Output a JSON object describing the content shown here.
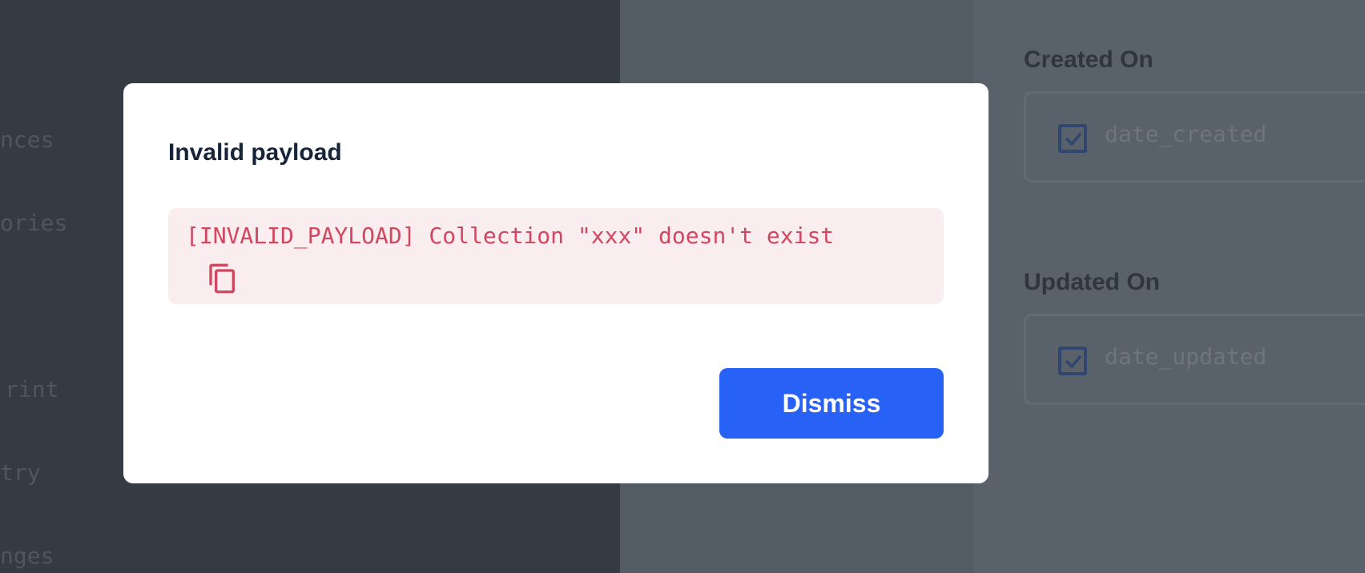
{
  "background": {
    "sidebar_items": [
      {
        "label": "nces"
      },
      {
        "label": "ories"
      },
      {
        "label": "rint"
      },
      {
        "label": "try"
      },
      {
        "label": "nges"
      }
    ],
    "fields": [
      {
        "label": "Created On",
        "value": "date_created",
        "checked": true
      },
      {
        "label": "Updated On",
        "value": "date_updated",
        "checked": true
      }
    ]
  },
  "dialog": {
    "title": "Invalid payload",
    "error_message": "[INVALID_PAYLOAD] Collection \"xxx\" doesn't exist",
    "copy_icon": "copy-icon",
    "dismiss_label": "Dismiss"
  },
  "colors": {
    "accent": "#2761f5",
    "error_text": "#d1475f",
    "error_bg": "#faedef"
  }
}
